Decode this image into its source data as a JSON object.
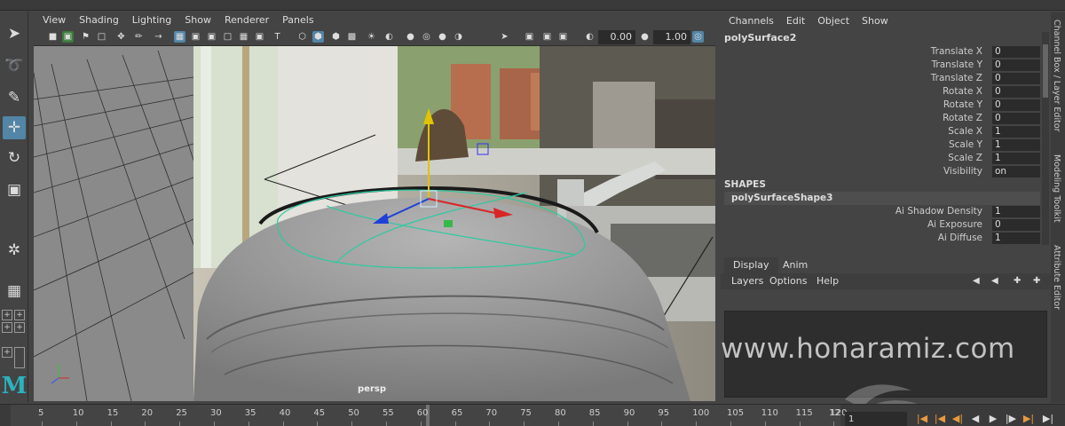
{
  "viewport": {
    "menus": [
      "View",
      "Shading",
      "Lighting",
      "Show",
      "Renderer",
      "Panels"
    ],
    "exposure": "0.00",
    "gamma": "1.00",
    "camera": "persp"
  },
  "channel_box": {
    "menus": [
      "Channels",
      "Edit",
      "Object",
      "Show"
    ],
    "object_name": "polySurface2",
    "attributes": [
      {
        "label": "Translate X",
        "value": "0"
      },
      {
        "label": "Translate Y",
        "value": "0"
      },
      {
        "label": "Translate Z",
        "value": "0"
      },
      {
        "label": "Rotate X",
        "value": "0"
      },
      {
        "label": "Rotate Y",
        "value": "0"
      },
      {
        "label": "Rotate Z",
        "value": "0"
      },
      {
        "label": "Scale X",
        "value": "1"
      },
      {
        "label": "Scale Y",
        "value": "1"
      },
      {
        "label": "Scale Z",
        "value": "1"
      },
      {
        "label": "Visibility",
        "value": "on"
      }
    ],
    "shapes_header": "SHAPES",
    "shape_name": "polySurfaceShape3",
    "shape_attributes": [
      {
        "label": "Ai Shadow Density",
        "value": "1"
      },
      {
        "label": "Ai Exposure",
        "value": "0"
      },
      {
        "label": "Ai Diffuse",
        "value": "1"
      }
    ]
  },
  "side_tabs": [
    "Channel Box / Layer Editor",
    "Modeling Toolkit",
    "Attribute Editor"
  ],
  "layer_editor": {
    "tabs": [
      "Display",
      "Anim"
    ],
    "active_tab": "Display",
    "menus": [
      "Layers",
      "Options",
      "Help"
    ]
  },
  "watermark": "www.honaramiz.com",
  "timeline": {
    "ticks": [
      "5",
      "10",
      "15",
      "20",
      "25",
      "30",
      "35",
      "40",
      "45",
      "50",
      "55",
      "60",
      "65",
      "70",
      "75",
      "80",
      "85",
      "90",
      "95",
      "100",
      "105",
      "110",
      "115",
      "120"
    ],
    "current_frame": "1",
    "playhead_frame": 61,
    "end_label": "12"
  },
  "colors": {
    "selection_accent": "#5285a6",
    "wireframe_selected": "#2ec9a0",
    "manip_x": "#d92626",
    "manip_y": "#e0c400",
    "manip_z": "#1f3fd9",
    "key_orange": "#e89a3e"
  }
}
